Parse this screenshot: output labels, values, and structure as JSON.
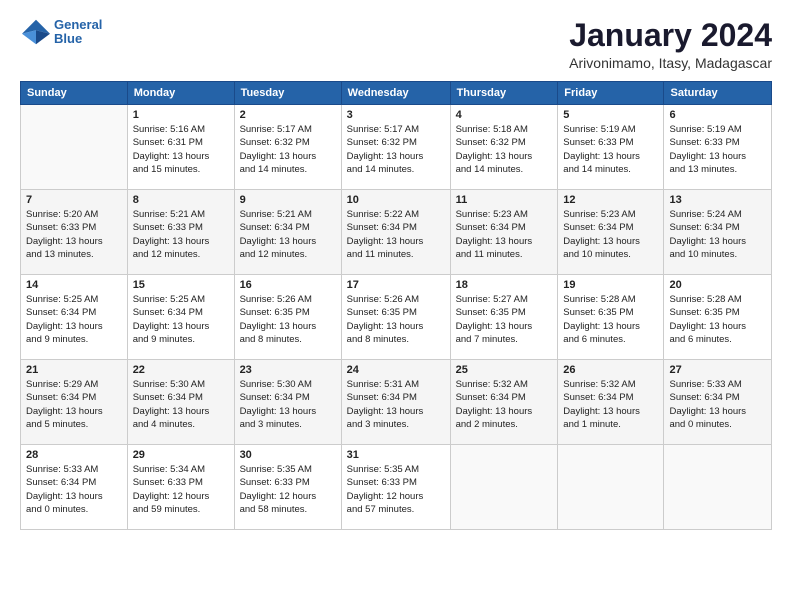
{
  "header": {
    "logo_line1": "General",
    "logo_line2": "Blue",
    "title": "January 2024",
    "subtitle": "Arivonimamo, Itasy, Madagascar"
  },
  "columns": [
    "Sunday",
    "Monday",
    "Tuesday",
    "Wednesday",
    "Thursday",
    "Friday",
    "Saturday"
  ],
  "weeks": [
    [
      {
        "day": "",
        "info": ""
      },
      {
        "day": "1",
        "info": "Sunrise: 5:16 AM\nSunset: 6:31 PM\nDaylight: 13 hours\nand 15 minutes."
      },
      {
        "day": "2",
        "info": "Sunrise: 5:17 AM\nSunset: 6:32 PM\nDaylight: 13 hours\nand 14 minutes."
      },
      {
        "day": "3",
        "info": "Sunrise: 5:17 AM\nSunset: 6:32 PM\nDaylight: 13 hours\nand 14 minutes."
      },
      {
        "day": "4",
        "info": "Sunrise: 5:18 AM\nSunset: 6:32 PM\nDaylight: 13 hours\nand 14 minutes."
      },
      {
        "day": "5",
        "info": "Sunrise: 5:19 AM\nSunset: 6:33 PM\nDaylight: 13 hours\nand 14 minutes."
      },
      {
        "day": "6",
        "info": "Sunrise: 5:19 AM\nSunset: 6:33 PM\nDaylight: 13 hours\nand 13 minutes."
      }
    ],
    [
      {
        "day": "7",
        "info": "Sunrise: 5:20 AM\nSunset: 6:33 PM\nDaylight: 13 hours\nand 13 minutes."
      },
      {
        "day": "8",
        "info": "Sunrise: 5:21 AM\nSunset: 6:33 PM\nDaylight: 13 hours\nand 12 minutes."
      },
      {
        "day": "9",
        "info": "Sunrise: 5:21 AM\nSunset: 6:34 PM\nDaylight: 13 hours\nand 12 minutes."
      },
      {
        "day": "10",
        "info": "Sunrise: 5:22 AM\nSunset: 6:34 PM\nDaylight: 13 hours\nand 11 minutes."
      },
      {
        "day": "11",
        "info": "Sunrise: 5:23 AM\nSunset: 6:34 PM\nDaylight: 13 hours\nand 11 minutes."
      },
      {
        "day": "12",
        "info": "Sunrise: 5:23 AM\nSunset: 6:34 PM\nDaylight: 13 hours\nand 10 minutes."
      },
      {
        "day": "13",
        "info": "Sunrise: 5:24 AM\nSunset: 6:34 PM\nDaylight: 13 hours\nand 10 minutes."
      }
    ],
    [
      {
        "day": "14",
        "info": "Sunrise: 5:25 AM\nSunset: 6:34 PM\nDaylight: 13 hours\nand 9 minutes."
      },
      {
        "day": "15",
        "info": "Sunrise: 5:25 AM\nSunset: 6:34 PM\nDaylight: 13 hours\nand 9 minutes."
      },
      {
        "day": "16",
        "info": "Sunrise: 5:26 AM\nSunset: 6:35 PM\nDaylight: 13 hours\nand 8 minutes."
      },
      {
        "day": "17",
        "info": "Sunrise: 5:26 AM\nSunset: 6:35 PM\nDaylight: 13 hours\nand 8 minutes."
      },
      {
        "day": "18",
        "info": "Sunrise: 5:27 AM\nSunset: 6:35 PM\nDaylight: 13 hours\nand 7 minutes."
      },
      {
        "day": "19",
        "info": "Sunrise: 5:28 AM\nSunset: 6:35 PM\nDaylight: 13 hours\nand 6 minutes."
      },
      {
        "day": "20",
        "info": "Sunrise: 5:28 AM\nSunset: 6:35 PM\nDaylight: 13 hours\nand 6 minutes."
      }
    ],
    [
      {
        "day": "21",
        "info": "Sunrise: 5:29 AM\nSunset: 6:34 PM\nDaylight: 13 hours\nand 5 minutes."
      },
      {
        "day": "22",
        "info": "Sunrise: 5:30 AM\nSunset: 6:34 PM\nDaylight: 13 hours\nand 4 minutes."
      },
      {
        "day": "23",
        "info": "Sunrise: 5:30 AM\nSunset: 6:34 PM\nDaylight: 13 hours\nand 3 minutes."
      },
      {
        "day": "24",
        "info": "Sunrise: 5:31 AM\nSunset: 6:34 PM\nDaylight: 13 hours\nand 3 minutes."
      },
      {
        "day": "25",
        "info": "Sunrise: 5:32 AM\nSunset: 6:34 PM\nDaylight: 13 hours\nand 2 minutes."
      },
      {
        "day": "26",
        "info": "Sunrise: 5:32 AM\nSunset: 6:34 PM\nDaylight: 13 hours\nand 1 minute."
      },
      {
        "day": "27",
        "info": "Sunrise: 5:33 AM\nSunset: 6:34 PM\nDaylight: 13 hours\nand 0 minutes."
      }
    ],
    [
      {
        "day": "28",
        "info": "Sunrise: 5:33 AM\nSunset: 6:34 PM\nDaylight: 13 hours\nand 0 minutes."
      },
      {
        "day": "29",
        "info": "Sunrise: 5:34 AM\nSunset: 6:33 PM\nDaylight: 12 hours\nand 59 minutes."
      },
      {
        "day": "30",
        "info": "Sunrise: 5:35 AM\nSunset: 6:33 PM\nDaylight: 12 hours\nand 58 minutes."
      },
      {
        "day": "31",
        "info": "Sunrise: 5:35 AM\nSunset: 6:33 PM\nDaylight: 12 hours\nand 57 minutes."
      },
      {
        "day": "",
        "info": ""
      },
      {
        "day": "",
        "info": ""
      },
      {
        "day": "",
        "info": ""
      }
    ]
  ]
}
